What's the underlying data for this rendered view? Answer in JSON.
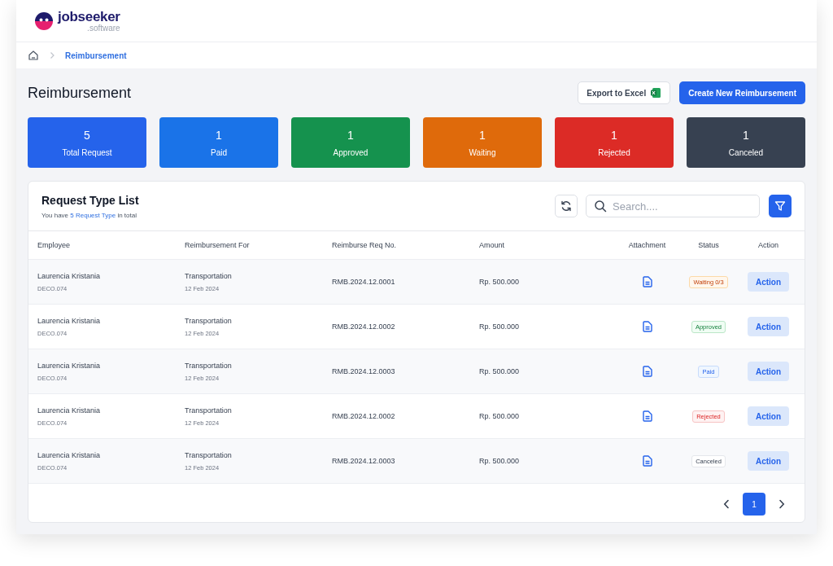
{
  "logo": {
    "name": "jobseeker",
    "suffix": ".software"
  },
  "breadcrumb": {
    "current": "Reimbursement"
  },
  "page_title": "Reimbursement",
  "buttons": {
    "export": "Export to Excel",
    "create": "Create New Reimbursement"
  },
  "stats": [
    {
      "kind": "total",
      "value": "5",
      "label": "Total Request"
    },
    {
      "kind": "paid",
      "value": "1",
      "label": "Paid"
    },
    {
      "kind": "approved",
      "value": "1",
      "label": "Approved"
    },
    {
      "kind": "waiting",
      "value": "1",
      "label": "Waiting"
    },
    {
      "kind": "rejected",
      "value": "1",
      "label": "Rejected"
    },
    {
      "kind": "canceled",
      "value": "1",
      "label": "Canceled"
    }
  ],
  "list": {
    "title": "Request Type List",
    "subtitle": {
      "before": "You have ",
      "highlight": "5 Request Type",
      "after": " in total"
    },
    "search": {
      "placeholder": "Search...."
    }
  },
  "table": {
    "columns": [
      "Employee",
      "Reimbursement For",
      "Reimburse Req No.",
      "Amount",
      "Attachment",
      "Status",
      "Action"
    ],
    "rows": [
      {
        "name": "Laurencia Kristania",
        "code": "DECO.074",
        "type": "Transportation",
        "date": "12 Feb 2024",
        "req_no": "RMB.2024.12.0001",
        "amount": "Rp. 500.000",
        "status": {
          "kind": "waiting",
          "label": "Waiting 0/3"
        },
        "action": "Action"
      },
      {
        "name": "Laurencia Kristania",
        "code": "DECO.074",
        "type": "Transportation",
        "date": "12 Feb 2024",
        "req_no": "RMB.2024.12.0002",
        "amount": "Rp. 500.000",
        "status": {
          "kind": "approved",
          "label": "Approved"
        },
        "action": "Action"
      },
      {
        "name": "Laurencia Kristania",
        "code": "DECO.074",
        "type": "Transportation",
        "date": "12 Feb 2024",
        "req_no": "RMB.2024.12.0003",
        "amount": "Rp. 500.000",
        "status": {
          "kind": "paid",
          "label": "Paid"
        },
        "action": "Action"
      },
      {
        "name": "Laurencia Kristania",
        "code": "DECO.074",
        "type": "Transportation",
        "date": "12 Feb 2024",
        "req_no": "RMB.2024.12.0002",
        "amount": "Rp. 500.000",
        "status": {
          "kind": "rejected",
          "label": "Rejected"
        },
        "action": "Action"
      },
      {
        "name": "Laurencia Kristania",
        "code": "DECO.074",
        "type": "Transportation",
        "date": "12 Feb 2024",
        "req_no": "RMB.2024.12.0003",
        "amount": "Rp. 500.000",
        "status": {
          "kind": "canceled",
          "label": "Canceled"
        },
        "action": "Action"
      }
    ]
  },
  "pagination": {
    "pages": [
      {
        "label": "1",
        "selected": true
      }
    ]
  }
}
